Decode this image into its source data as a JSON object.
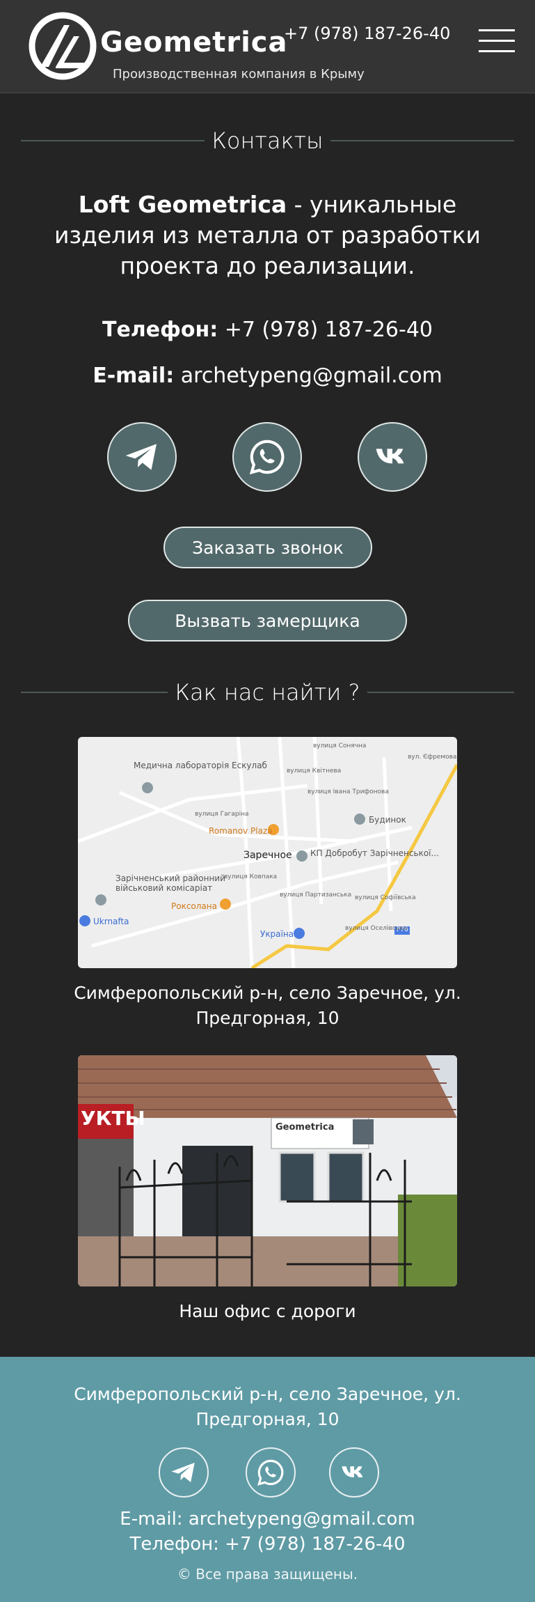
{
  "header": {
    "brand": "Geometrica",
    "tagline": "Производственная компания в Крыму",
    "phone": "+7 (978) 187-26-40",
    "menu_icon": "hamburger-icon"
  },
  "contacts": {
    "title": "Контакты",
    "intro_bold": "Loft Geometrica",
    "intro_rest": " - уникальные изделия из металла от разработки проекта до реализации.",
    "phone_label": "Телефон:",
    "phone_value": " +7 (978) 187-26-40",
    "email_label": "E-mail:",
    "email_value": " archetypeng@gmail.com",
    "social": [
      "telegram-icon",
      "whatsapp-icon",
      "vk-icon"
    ],
    "call_button": "Заказать звонок",
    "measure_button": "Вызвать замерщика"
  },
  "location": {
    "title": "Как нас найти ?",
    "map_labels": {
      "lab": "Медична лабораторія Ескулаб",
      "romanov": "Romanov Plaza",
      "center": "Заречное",
      "kp": "КП Добробут Зарічненської...",
      "budynok": "Будинок",
      "military": "Зарічненський районний військовий комісаріат",
      "roksolana": "Роксолана",
      "ukrnafta": "Ukrnafta",
      "ukraina": "Україна",
      "road": "P76",
      "st_sonyachna": "вулиця Сонячна",
      "st_kvitneva": "вулиця Квітнева",
      "st_tryfonova": "вулиця Івана Трифонова",
      "st_efremova": "вул. Єфремова",
      "st_gagarina": "вулиця Гагаріна",
      "st_kovpaka": "вулиця Ковпака",
      "st_partyzanska": "вулиця Партизанська",
      "st_sofiivska": "вулиця Софіївська",
      "st_oselivska": "вулиця Оселівська"
    },
    "map_caption": "Симферопольский р-н, село Заречное, ул. Предгорная, 10",
    "photo_sign": "Geometrica",
    "photo_shop": "УКТЫ",
    "photo_caption": "Наш офис с дороги"
  },
  "footer": {
    "address": "Симферопольский р-н, село Заречное, ул. Предгорная, 10",
    "social": [
      "telegram-icon",
      "whatsapp-icon",
      "vk-icon"
    ],
    "email": "E-mail: archetypeng@gmail.com",
    "phone": "Телефон: +7 (978) 187-26-40",
    "copyright": "© Все права защищены."
  },
  "colors": {
    "background": "#242424",
    "header": "#343434",
    "button": "#52696b",
    "footer": "#5f9ba5"
  }
}
